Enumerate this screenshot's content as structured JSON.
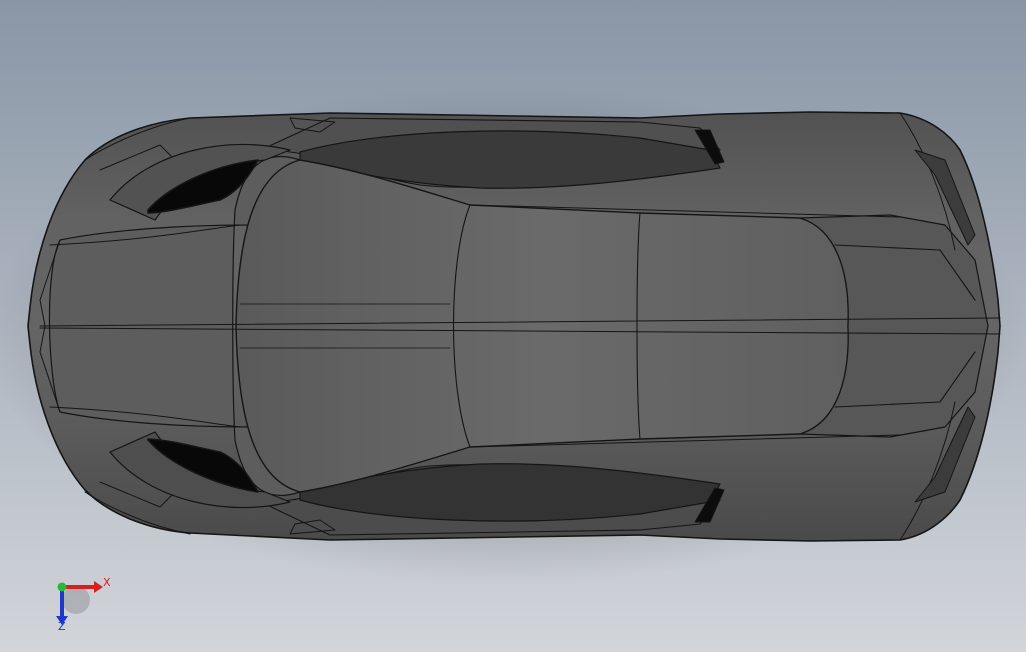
{
  "colors": {
    "background_top": "#8996a6",
    "background_bottom": "#d2d5da",
    "body_main": "#5e5e5e",
    "body_light": "#6a6a6a",
    "body_dark": "#474747",
    "edge_line": "#151515",
    "window_dark": "#2f2f2f",
    "intake_black": "#080808",
    "axis_x": "#d61f1f",
    "axis_y": "#27b83a",
    "axis_z": "#2038c8"
  },
  "triad": {
    "x_label": "X",
    "z_label": "Z",
    "x_axis_icon": "x-axis-arrow-icon",
    "y_axis_icon": "y-axis-dot-icon",
    "z_axis_icon": "z-axis-arrow-icon"
  }
}
